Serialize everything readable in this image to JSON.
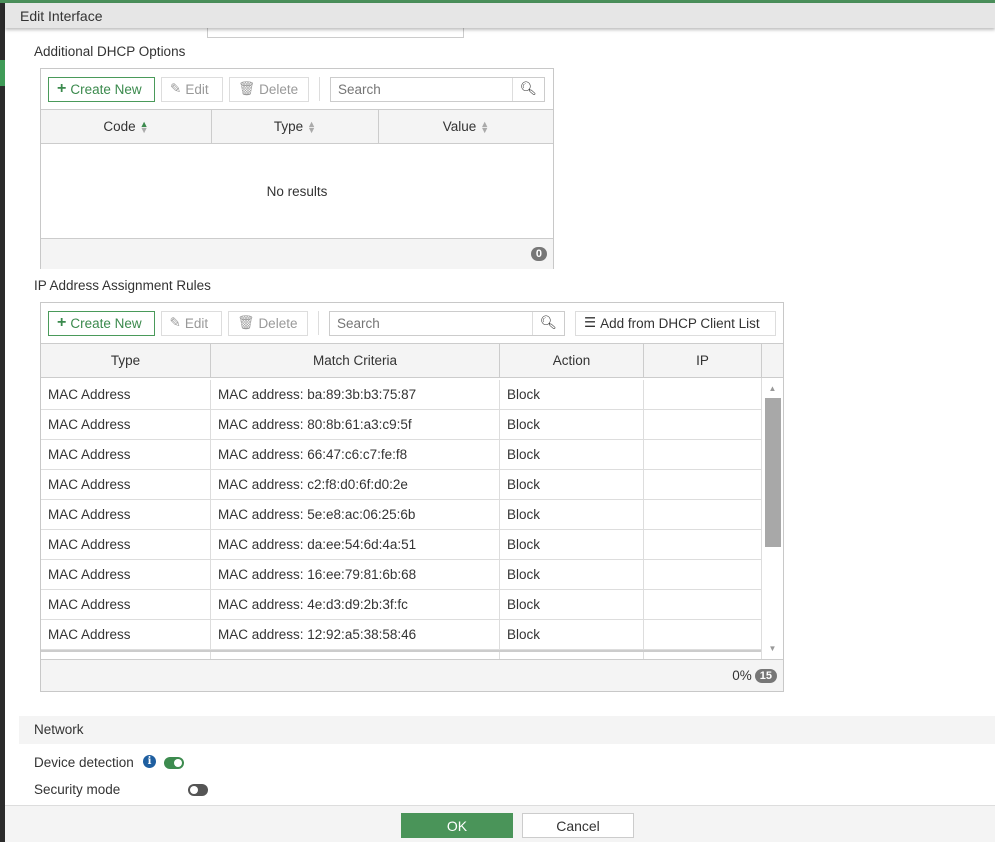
{
  "dialog": {
    "title": "Edit Interface"
  },
  "dhcp_options": {
    "heading": "Additional DHCP Options",
    "toolbar": {
      "create": "Create New",
      "edit": "Edit",
      "delete": "Delete",
      "search_placeholder": "Search"
    },
    "columns": [
      "Code",
      "Type",
      "Value"
    ],
    "empty": "No results",
    "count": "0"
  },
  "assign_rules": {
    "heading": "IP Address Assignment Rules",
    "toolbar": {
      "create": "Create New",
      "edit": "Edit",
      "delete": "Delete",
      "search_placeholder": "Search",
      "add_from": "Add from DHCP Client List"
    },
    "columns": [
      "Type",
      "Match Criteria",
      "Action",
      "IP"
    ],
    "rows": [
      [
        "MAC Address",
        "MAC address: ba:89:3b:b3:75:87",
        "Block",
        ""
      ],
      [
        "MAC Address",
        "MAC address: 80:8b:61:a3:c9:5f",
        "Block",
        ""
      ],
      [
        "MAC Address",
        "MAC address: 66:47:c6:c7:fe:f8",
        "Block",
        ""
      ],
      [
        "MAC Address",
        "MAC address: c2:f8:d0:6f:d0:2e",
        "Block",
        ""
      ],
      [
        "MAC Address",
        "MAC address: 5e:e8:ac:06:25:6b",
        "Block",
        ""
      ],
      [
        "MAC Address",
        "MAC address: da:ee:54:6d:4a:51",
        "Block",
        ""
      ],
      [
        "MAC Address",
        "MAC address: 16:ee:79:81:6b:68",
        "Block",
        ""
      ],
      [
        "MAC Address",
        "MAC address: 4e:d3:d9:2b:3f:fc",
        "Block",
        ""
      ],
      [
        "MAC Address",
        "MAC address: 12:92:a5:38:58:46",
        "Block",
        ""
      ]
    ],
    "progress": "0%",
    "count": "15"
  },
  "network": {
    "heading": "Network",
    "device_detection": "Device detection",
    "device_detection_on": true,
    "security_mode": "Security mode",
    "security_mode_on": false
  },
  "footer": {
    "ok": "OK",
    "cancel": "Cancel"
  },
  "colors": {
    "accent": "#4a9a5a",
    "info": "#1f5fa0"
  }
}
